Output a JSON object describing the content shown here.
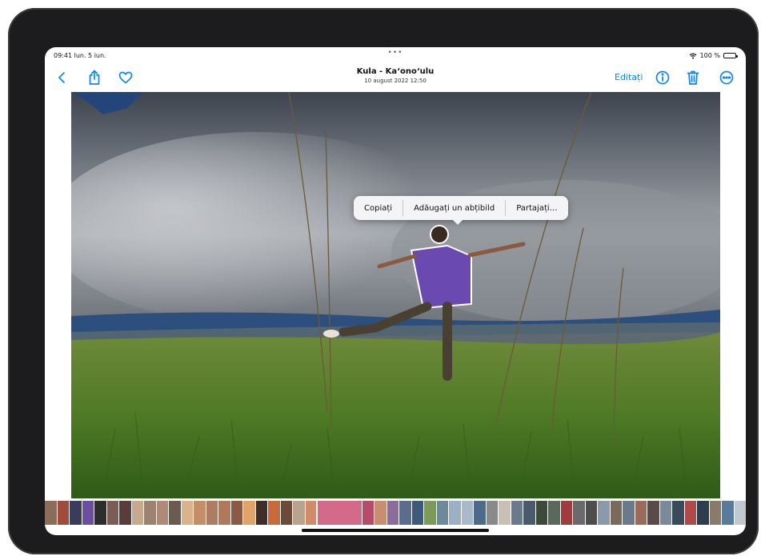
{
  "statusbar": {
    "time": "09:41",
    "date": "lun. 5 iun.",
    "multitask_dots": "•••",
    "wifi_icon": "wifi-icon",
    "battery_text": "100 %",
    "battery_level": 1.0
  },
  "navbar": {
    "title": "Kula - Ka‘ono‘ulu",
    "subtitle": "10 august 2022 12:50",
    "edit_label": "Editați",
    "icons": {
      "back": "chevron-left-icon",
      "share": "share-icon",
      "favorite": "heart-icon",
      "info": "info-icon",
      "trash": "trash-icon",
      "more": "ellipsis-circle-icon"
    },
    "accent_color": "#0a84ff"
  },
  "context_menu": {
    "items": [
      "Copiați",
      "Adăugați un abțibild",
      "Partajați…"
    ]
  },
  "filmstrip": {
    "thumb_colors": [
      "#8a6d5a",
      "#a04b3c",
      "#3b3b5c",
      "#6a4fa0",
      "#2d2d2d",
      "#7a5d55",
      "#5b3c3c",
      "#c7a98e",
      "#9c8270",
      "#b08a77",
      "#6d5a4f",
      "#d9b38c",
      "#c48e6a",
      "#ad7c62",
      "#b07a5a",
      "#8a5a45",
      "#e0a36a",
      "#3e2e2a",
      "#c86a3c",
      "#6b4a3a",
      "#b9a38f",
      "#d28b6a",
      "#d46a8a",
      "#b84b6a",
      "#c59070",
      "#8a6d9a",
      "#5a6d8a",
      "#3d5a7a",
      "#7d9a5a",
      "#6d8a9a",
      "#9ab0c4",
      "#a9b9c9",
      "#4d6a8a",
      "#8a8a8a",
      "#c9c0b5",
      "#6b7a8a",
      "#4a5a6a",
      "#3d4a3a",
      "#5a6a5a",
      "#a03c3c",
      "#6a6a6a",
      "#4d4d4d",
      "#8a9aaa",
      "#7a6a5a",
      "#6a7a8a",
      "#9a6a5a",
      "#5a4a4a",
      "#7a8a9a",
      "#3a4a5a",
      "#b04a4a",
      "#2d3d4d",
      "#8a7a6a",
      "#5a7a9a",
      "#c0c8d0"
    ],
    "selected_index": 22
  }
}
